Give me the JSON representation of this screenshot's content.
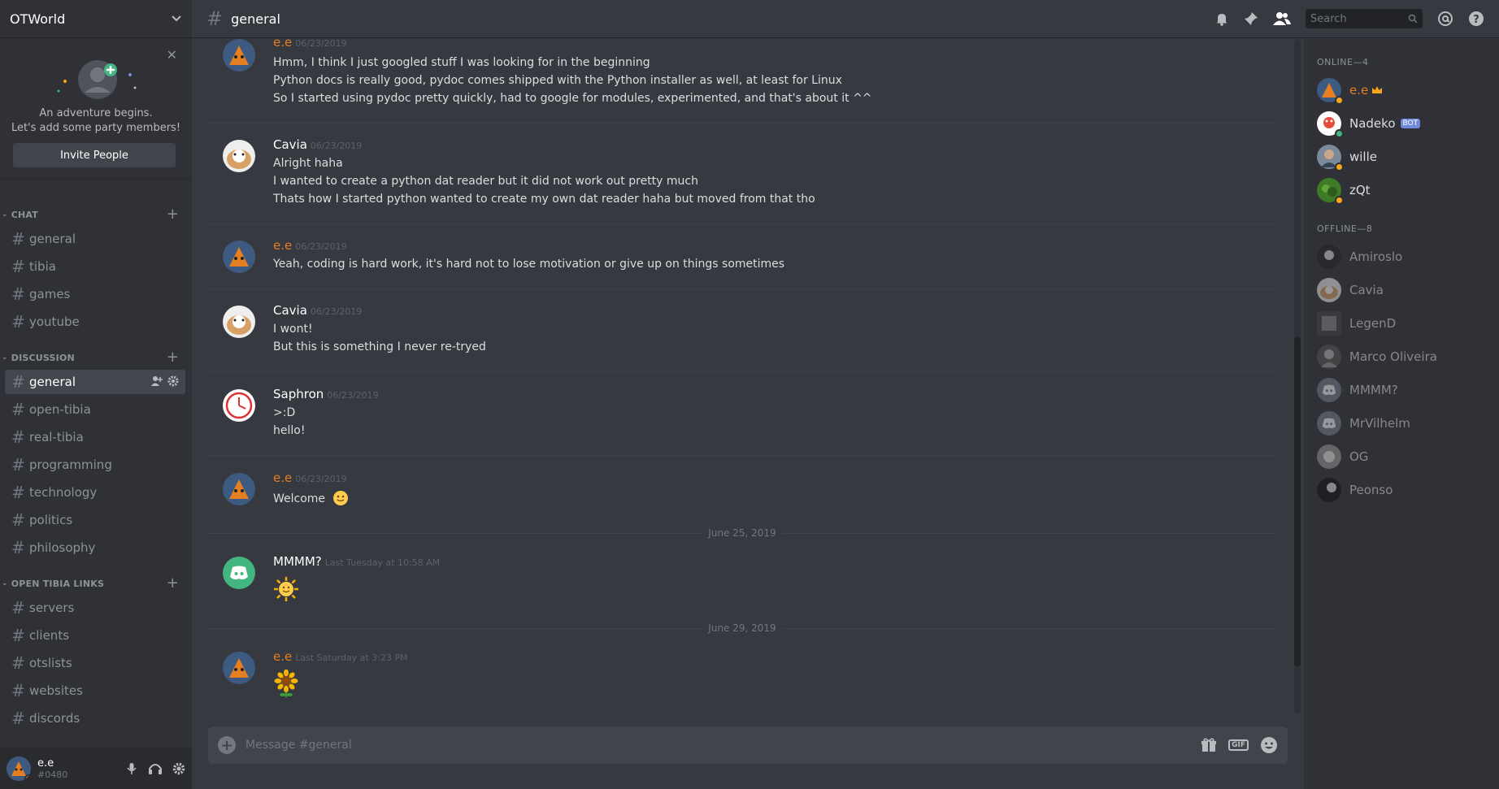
{
  "server": {
    "name": "OTWorld"
  },
  "invite": {
    "line1": "An adventure begins.",
    "line2": "Let's add some party members!",
    "button": "Invite People"
  },
  "categories": [
    {
      "name": "CHAT",
      "channels": [
        "general",
        "tibia",
        "games",
        "youtube"
      ]
    },
    {
      "name": "DISCUSSION",
      "channels": [
        "general",
        "open-tibia",
        "real-tibia",
        "programming",
        "technology",
        "politics",
        "philosophy"
      ]
    },
    {
      "name": "OPEN TIBIA LINKS",
      "channels": [
        "servers",
        "clients",
        "otslists",
        "websites",
        "discords"
      ]
    }
  ],
  "user": {
    "name": "e.e",
    "tag": "#0480"
  },
  "channel": {
    "name": "general"
  },
  "search": {
    "placeholder": "Search"
  },
  "messages": [
    {
      "author": "e.e",
      "time": "06/23/2019",
      "lines": [
        "Hmm, I think I just googled stuff I was looking for in the beginning",
        "Python docs is really good, pydoc comes shipped with the Python installer as well, at least for Linux",
        "So I started using pydoc pretty quickly, had to google for modules, experimented, and that's about it ^^"
      ]
    },
    {
      "author": "Cavia",
      "time": "06/23/2019",
      "lines": [
        "Alright haha",
        "I wanted to create a python dat reader but it did not work out pretty much",
        "Thats how I started python wanted to create my own dat reader haha but moved from that tho"
      ]
    },
    {
      "author": "e.e",
      "time": "06/23/2019",
      "lines": [
        "Yeah, coding is hard work, it's hard not to lose motivation or give up on things sometimes"
      ]
    },
    {
      "author": "Cavia",
      "time": "06/23/2019",
      "lines": [
        "I wont!",
        "But this is something I never re-tryed"
      ]
    },
    {
      "author": "Saphron",
      "time": "06/23/2019",
      "lines": [
        ">:D",
        "hello!"
      ]
    },
    {
      "author": "e.e",
      "time": "06/23/2019",
      "lines": [
        "Welcome"
      ]
    },
    {
      "author": "MMMM?",
      "time": "Last Tuesday at 10:58 AM",
      "lines": []
    },
    {
      "author": "e.e",
      "time": "Last Saturday at 3:23 PM",
      "lines": []
    }
  ],
  "date_separators": [
    "June 25, 2019",
    "June 29, 2019"
  ],
  "composer": {
    "placeholder": "Message #general"
  },
  "members": {
    "online_label": "ONLINE—4",
    "offline_label": "OFFLINE—8",
    "online": [
      "e.e",
      "Nadeko",
      "wille",
      "zQt"
    ],
    "bot_label": "BOT",
    "offline": [
      "Amiroslo",
      "Cavia",
      "LegenD",
      "Marco Oliveira",
      "MMMM?",
      "MrVilhelm",
      "OG",
      "Peonso"
    ]
  },
  "colors": {
    "accent": "#e67e22",
    "online": "#43b581",
    "idle": "#faa61a",
    "background": "#36393f"
  }
}
